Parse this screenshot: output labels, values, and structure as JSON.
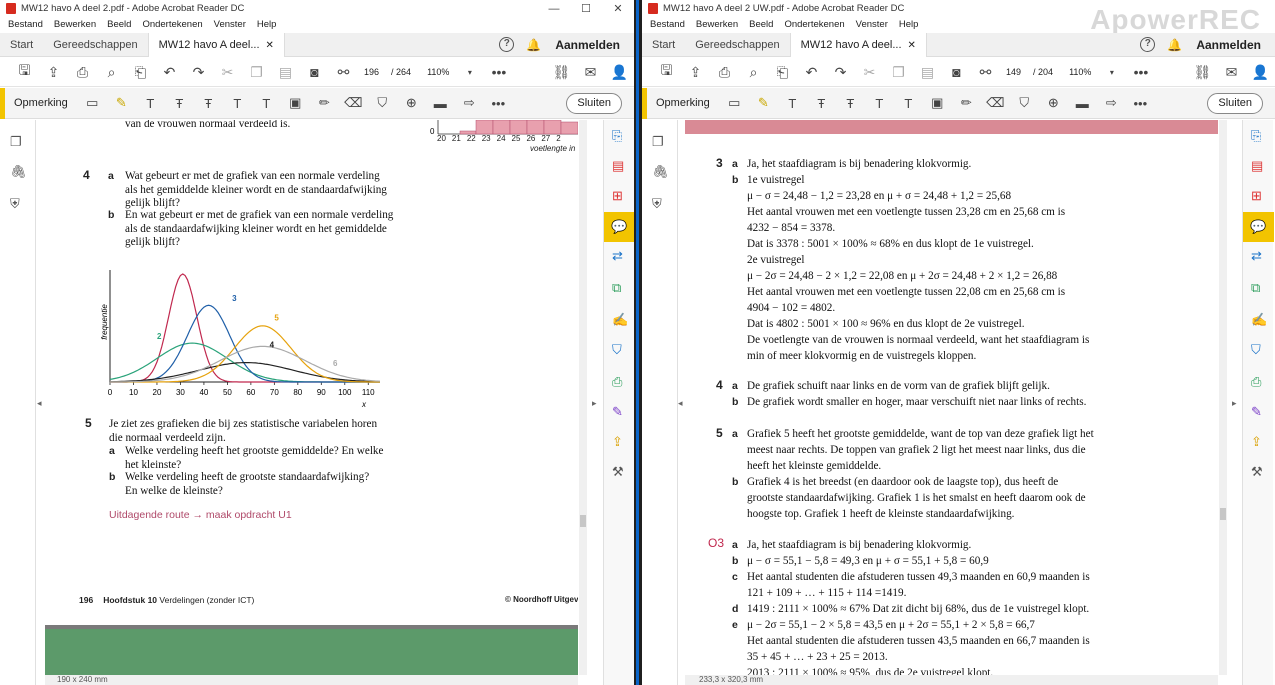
{
  "left": {
    "title": "MW12 havo A deel 2.pdf - Adobe Acrobat Reader DC",
    "menu": [
      "Bestand",
      "Bewerken",
      "Beeld",
      "Ondertekenen",
      "Venster",
      "Help"
    ],
    "tabs": {
      "start": "Start",
      "tools": "Gereedschappen",
      "doc": "MW12 havo A deel..."
    },
    "signin": "Aanmelden",
    "page_current": "196",
    "page_total": "/ 264",
    "zoom": "110%",
    "comment_title": "Opmerking",
    "close_label": "Sluiten",
    "status_size": "190 x 240 mm",
    "content": {
      "top_line": "van de vrouwen normaal verdeeld is.",
      "hist_axis_ticks": [
        "20",
        "21",
        "22",
        "23",
        "24",
        "25",
        "26",
        "27",
        "2"
      ],
      "hist_axis_label": "voetlengte in",
      "hist_zero": "0",
      "q4_num": "4",
      "q4a_letter": "a",
      "q4a": [
        "Wat gebeurt er met de grafiek van een normale verdeling",
        "als het gemiddelde kleiner wordt en de standaardafwijking",
        "gelijk blijft?"
      ],
      "q4b_letter": "b",
      "q4b": [
        "En wat gebeurt er met de grafiek van een normale verdeling",
        "als de standaardafwijking kleiner wordt en het gemiddelde",
        "gelijk blijft?"
      ],
      "q5_num": "5",
      "q5": [
        "Je ziet zes grafieken die bij zes statistische variabelen horen",
        "die normaal verdeeld zijn."
      ],
      "q5a_letter": "a",
      "q5a": [
        "Welke verdeling heeft het grootste gemiddelde? En welke",
        "het kleinste?"
      ],
      "q5b_letter": "b",
      "q5b": [
        "Welke verdeling heeft de grootste standaardafwijking?",
        "En welke de kleinste?"
      ],
      "route": "Uitdagende route → maak opdracht U1",
      "footer_page": "196",
      "footer_chapter": "Hoofdstuk 10",
      "footer_title": "Verdelingen (zonder ICT)",
      "footer_publisher": "© Noordhoff Uitgev"
    }
  },
  "chart_data": {
    "type": "line",
    "ylabel": "frequentie",
    "xlabel": "x",
    "x_ticks": [
      0,
      10,
      20,
      30,
      40,
      50,
      60,
      70,
      80,
      90,
      100,
      110
    ],
    "xlim": [
      0,
      115
    ],
    "series": [
      {
        "name": "1",
        "mean": 31,
        "sd": 6,
        "peak": 1.0,
        "color": "#c0284e"
      },
      {
        "name": "2",
        "mean": 35,
        "sd": 15,
        "peak": 0.36,
        "color": "#2aa37a"
      },
      {
        "name": "3",
        "mean": 42,
        "sd": 9,
        "peak": 0.71,
        "color": "#1f5fa8"
      },
      {
        "name": "4",
        "mean": 58,
        "sd": 20,
        "peak": 0.18,
        "color": "#222222"
      },
      {
        "name": "5",
        "mean": 65,
        "sd": 12,
        "peak": 0.52,
        "color": "#e6a20c"
      },
      {
        "name": "6",
        "mean": 65,
        "sd": 18,
        "peak": 0.33,
        "color": "#aaaaaa"
      }
    ]
  },
  "right": {
    "title": "MW12 havo A deel 2 UW.pdf - Adobe Acrobat Reader DC",
    "watermark": "ApowerREC",
    "menu": [
      "Bestand",
      "Bewerken",
      "Beeld",
      "Ondertekenen",
      "Venster",
      "Help"
    ],
    "tabs": {
      "start": "Start",
      "tools": "Gereedschappen",
      "doc": "MW12 havo A deel..."
    },
    "signin": "Aanmelden",
    "page_current": "149",
    "page_total": "/ 204",
    "zoom": "110%",
    "comment_title": "Opmerking",
    "close_label": "Sluiten",
    "status_size": "233,3 x 320,3 mm",
    "answers": {
      "a3_num": "3",
      "a3a_letter": "a",
      "a3a": "Ja, het staafdiagram is bij benadering klokvormig.",
      "a3b_letter": "b",
      "a3b": [
        "1e vuistregel",
        "μ − σ = 24,48 − 1,2 = 23,28 en μ + σ = 24,48 + 1,2 = 25,68",
        "Het aantal vrouwen met een voetlengte tussen 23,28 cm en 25,68 cm is",
        "4232 − 854 = 3378.",
        "Dat is 3378 : 5001 × 100% ≈ 68% en dus klopt de 1e vuistregel.",
        "2e vuistregel",
        "μ − 2σ = 24,48 − 2 × 1,2 = 22,08 en μ + 2σ = 24,48 + 2 × 1,2 = 26,88",
        "Het aantal vrouwen met een voetlengte tussen 22,08 cm en 25,68 cm is",
        "4904 − 102 = 4802.",
        "Dat is 4802 : 5001 × 100 ≈ 96% en dus klopt de 2e vuistregel.",
        "De voetlengte van de vrouwen is normaal verdeeld, want het staafdiagram is",
        "min of meer klokvormig en de vuistregels kloppen."
      ],
      "a4_num": "4",
      "a4a_letter": "a",
      "a4a": "De grafiek schuift naar links en de vorm van de grafiek blijft gelijk.",
      "a4b_letter": "b",
      "a4b": "De grafiek wordt smaller en hoger, maar verschuift niet naar links of rechts.",
      "a5_num": "5",
      "a5a_letter": "a",
      "a5a": [
        "Grafiek 5 heeft het grootste gemiddelde, want de top van deze grafiek ligt het",
        "meest naar rechts. De toppen van grafiek 2 ligt het meest naar links, dus die",
        "heeft het kleinste gemiddelde."
      ],
      "a5b_letter": "b",
      "a5b": [
        "Grafiek 4 is het breedst (en daardoor ook de laagste top), dus heeft de",
        "grootste standaardafwijking. Grafiek 1 is het smalst en heeft daarom ook de",
        "hoogste top. Grafiek 1 heeft de kleinste standaardafwijking."
      ],
      "o3_num": "O3",
      "o3a_letter": "a",
      "o3a": "Ja, het staafdiagram is bij benadering klokvormig.",
      "o3b_letter": "b",
      "o3b": "μ − σ = 55,1 − 5,8 = 49,3 en μ + σ = 55,1 + 5,8 = 60,9",
      "o3c_letter": "c",
      "o3c": [
        "Het aantal studenten die afstuderen tussen 49,3 maanden en 60,9 maanden is",
        "121 + 109 + … + 115 + 114 =1419."
      ],
      "o3d_letter": "d",
      "o3d": "1419 : 2111 × 100% ≈ 67% Dat zit dicht bij 68%, dus de 1e vuistregel klopt.",
      "o3e_letter": "e",
      "o3e": [
        "μ − 2σ = 55,1 − 2 × 5,8 = 43,5 en μ + 2σ = 55,1 + 2 × 5,8 = 66,7",
        "Het aantal studenten die afstuderen tussen 43,5 maanden en 66,7 maanden is",
        "35 + 45 + … + 23 + 25 = 2013.",
        "2013 : 2111 × 100% ≈ 95%, dus de 2e vuistregel klopt."
      ]
    }
  },
  "colors": {
    "accent": "#f2c400",
    "route": "#b04a6a",
    "answer_num_red": "#c0284e",
    "hist_fill": "#e8a0ae"
  }
}
